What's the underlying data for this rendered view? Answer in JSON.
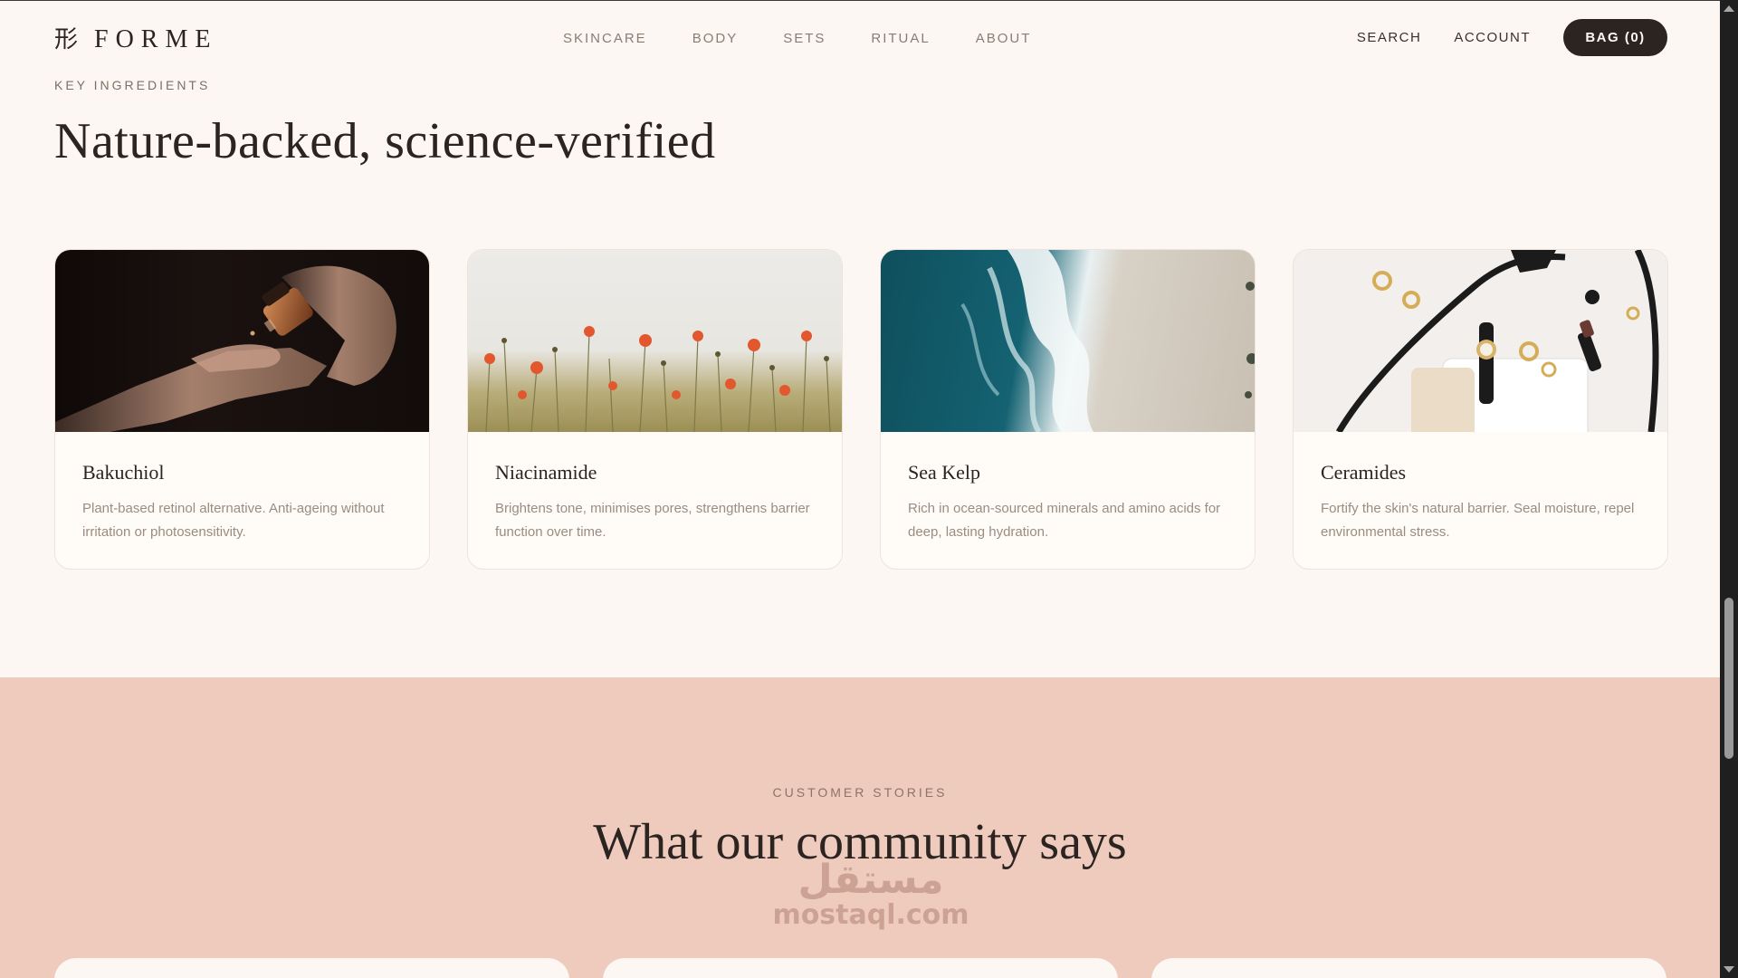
{
  "header": {
    "logo_mark": "形",
    "logo_text": "FORME",
    "nav": [
      {
        "label": "SKINCARE"
      },
      {
        "label": "BODY"
      },
      {
        "label": "SETS"
      },
      {
        "label": "RITUAL"
      },
      {
        "label": "ABOUT"
      }
    ],
    "search_label": "SEARCH",
    "account_label": "ACCOUNT",
    "bag_label": "BAG (0)"
  },
  "ingredients": {
    "eyebrow": "KEY INGREDIENTS",
    "title": "Nature-backed, science-verified",
    "cards": [
      {
        "title": "Bakuchiol",
        "description": "Plant-based retinol alternative. Anti-ageing without irritation or photosensitivity.",
        "image": "dropper-bottle-hand-photo"
      },
      {
        "title": "Niacinamide",
        "description": "Brightens tone, minimises pores, strengthens barrier function over time.",
        "image": "poppy-field-photo"
      },
      {
        "title": "Sea Kelp",
        "description": "Rich in ocean-sourced minerals and amino acids for deep, lasting hydration.",
        "image": "ocean-shore-aerial-photo"
      },
      {
        "title": "Ceramides",
        "description": "Fortify the skin's natural barrier. Seal moisture, repel environmental stress.",
        "image": "accessories-flatlay-photo"
      }
    ]
  },
  "community": {
    "eyebrow": "CUSTOMER STORIES",
    "title": "What our community says"
  },
  "watermark": {
    "arabic": "مستقل",
    "latin": "mostaql.com"
  },
  "colors": {
    "background": "#fcf7f2",
    "community_bg": "#efcbbd",
    "bag_button": "#2b2420",
    "muted_text": "#9a8c80"
  }
}
